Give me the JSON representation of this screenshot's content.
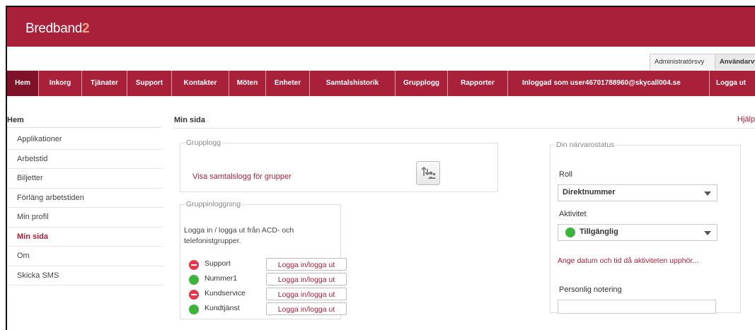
{
  "brand": {
    "name_main": "Bredband",
    "name_suffix": "2"
  },
  "view_tabs": {
    "admin": "Administratörsvy",
    "user": "Användarvy"
  },
  "nav": {
    "items": [
      "Hem",
      "Inkorg",
      "Tjänater",
      "Support",
      "Kontakter",
      "Möten",
      "Enheter",
      "Samtalshistorik",
      "Grupplogg",
      "Rapporter"
    ],
    "active": "Hem",
    "user_text": "Inloggad som user46701788960@skycall004.se",
    "logout": "Logga ut"
  },
  "sidebar": {
    "title": "Hem",
    "items": [
      "Applikationer",
      "Arbetstid",
      "Biljetter",
      "Förläng arbetstiden",
      "Min profil",
      "Min sida",
      "Om",
      "Skicka SMS"
    ],
    "active": "Min sida"
  },
  "main": {
    "title": "Min sida",
    "help": "Hjälp",
    "grupplogg": {
      "legend": "Grupplogg",
      "link": "Visa samtalslogg för grupper",
      "icon": "group-transfer-icon"
    },
    "gruppinloggning": {
      "legend": "Gruppinloggning",
      "description": "Logga in / logga ut från ACD- och telefonistgrupper.",
      "button_label": "Logga in/logga ut",
      "groups": [
        {
          "name": "Support",
          "status": "red"
        },
        {
          "name": "Nummer1",
          "status": "green"
        },
        {
          "name": "Kundservice",
          "status": "red"
        },
        {
          "name": "Kundtjänst",
          "status": "green"
        }
      ]
    },
    "presence": {
      "legend": "Din närvarostatus",
      "role_label": "Roll",
      "role_value": "Direktnummer",
      "activity_label": "Aktivitet",
      "activity_value": "Tillgänglig",
      "activity_color": "#3cb43c",
      "end_link": "Ange datum och tid då aktiviteten upphör...",
      "note_label": "Personlig notering",
      "note_value": ""
    }
  },
  "colors": {
    "brand": "#a8203a",
    "nav_active": "#7e1228",
    "status_green": "#3cb43c",
    "status_red": "#e23a4a"
  }
}
